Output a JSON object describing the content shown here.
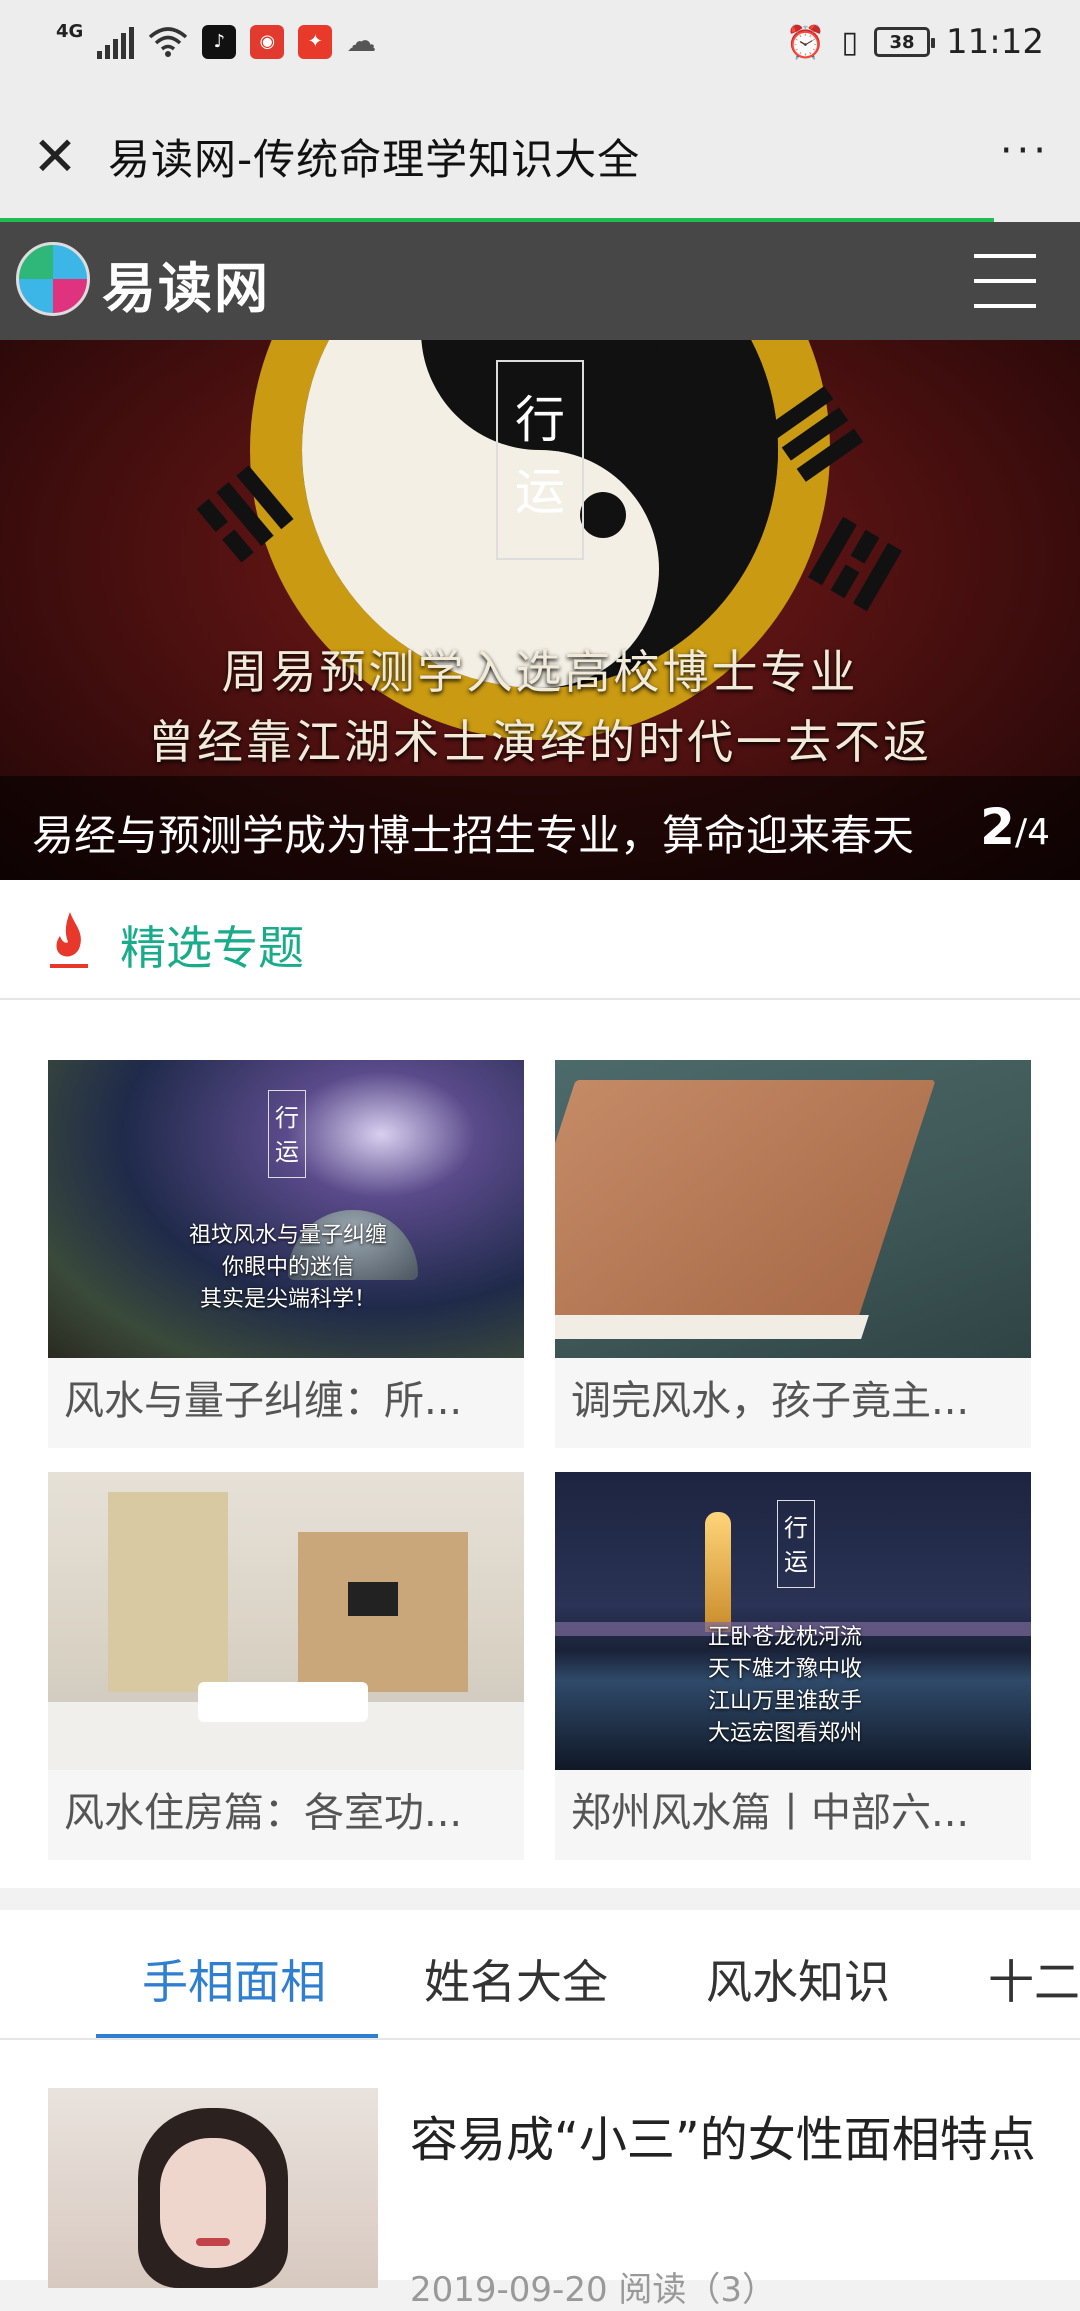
{
  "status_bar": {
    "network": "4G",
    "battery": "38",
    "time": "11:12",
    "icons": [
      "signal-icon",
      "wifi-icon",
      "tiktok-icon",
      "netease-music-icon",
      "app-icon",
      "cloud-icon",
      "alarm-icon",
      "vibrate-icon",
      "battery-icon"
    ]
  },
  "titlebar": {
    "title": "易读网-传统命理学知识大全",
    "close_symbol": "✕",
    "more_symbol": "···",
    "load_progress": 0.92
  },
  "site_header": {
    "logo_text": "易读网"
  },
  "banner": {
    "tag": [
      "行",
      "运"
    ],
    "line1": "周易预测学入选高校博士专业",
    "line2": "曾经靠江湖术士演绎的时代一去不返",
    "caption": "易经与预测学成为博士招生专业，算命迎来春天",
    "current_page": "2",
    "total_pages": "/4"
  },
  "featured": {
    "title": "精选专题",
    "cards": [
      {
        "title": "风水与量子纠缠：所...",
        "img_tag": [
          "行",
          "运"
        ],
        "img_text": [
          "祖坟风水与量子纠缠",
          "你眼中的迷信",
          "其实是尖端科学！"
        ]
      },
      {
        "title": "调完风水，孩子竟主..."
      },
      {
        "title": "风水住房篇：各室功..."
      },
      {
        "title": "郑州风水篇丨中部六...",
        "img_tag": [
          "行",
          "运"
        ],
        "img_text": [
          "正卧苍龙枕河流",
          "天下雄才豫中收",
          "江山万里谁敌手",
          "大运宏图看郑州"
        ]
      }
    ]
  },
  "tabs": {
    "items": [
      "手相面相",
      "姓名大全",
      "风水知识",
      "十二"
    ],
    "active": 0
  },
  "articles": [
    {
      "title": "容易成“小三”的女性面相特点",
      "meta": "2019-09-20    阅读（3）"
    }
  ],
  "colors": {
    "accent_green": "#1aab8a",
    "tab_blue": "#2f7fd0",
    "progress_green": "#1fbd4d",
    "header_bg": "#474747"
  }
}
